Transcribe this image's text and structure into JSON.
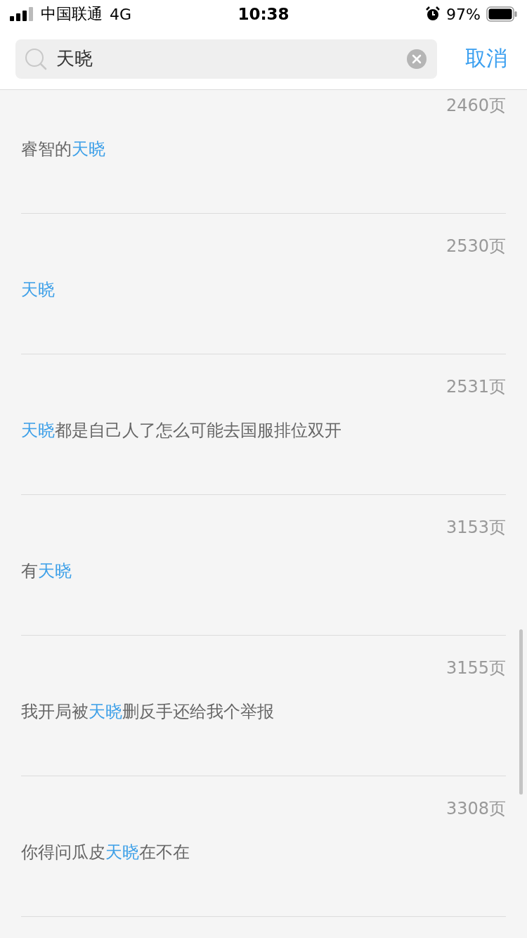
{
  "status_bar": {
    "carrier": "中国联通",
    "network": "4G",
    "time": "10:38",
    "battery": "97%"
  },
  "search": {
    "value": "天晓",
    "cancel": "取消"
  },
  "results": [
    {
      "page": "2460页",
      "parts": [
        {
          "text": "睿智的",
          "highlight": false
        },
        {
          "text": "天晓",
          "highlight": true
        }
      ]
    },
    {
      "page": "2530页",
      "parts": [
        {
          "text": "天晓",
          "highlight": true
        }
      ]
    },
    {
      "page": "2531页",
      "parts": [
        {
          "text": "天晓",
          "highlight": true
        },
        {
          "text": "都是自己人了怎么可能去国服排位双开",
          "highlight": false
        }
      ]
    },
    {
      "page": "3153页",
      "parts": [
        {
          "text": "有",
          "highlight": false
        },
        {
          "text": "天晓",
          "highlight": true
        }
      ]
    },
    {
      "page": "3155页",
      "parts": [
        {
          "text": "我开局被",
          "highlight": false
        },
        {
          "text": "天晓",
          "highlight": true
        },
        {
          "text": "删反手还给我个举报",
          "highlight": false
        }
      ]
    },
    {
      "page": "3308页",
      "parts": [
        {
          "text": "你得问瓜皮",
          "highlight": false
        },
        {
          "text": "天晓",
          "highlight": true
        },
        {
          "text": "在不在",
          "highlight": false
        }
      ]
    }
  ]
}
